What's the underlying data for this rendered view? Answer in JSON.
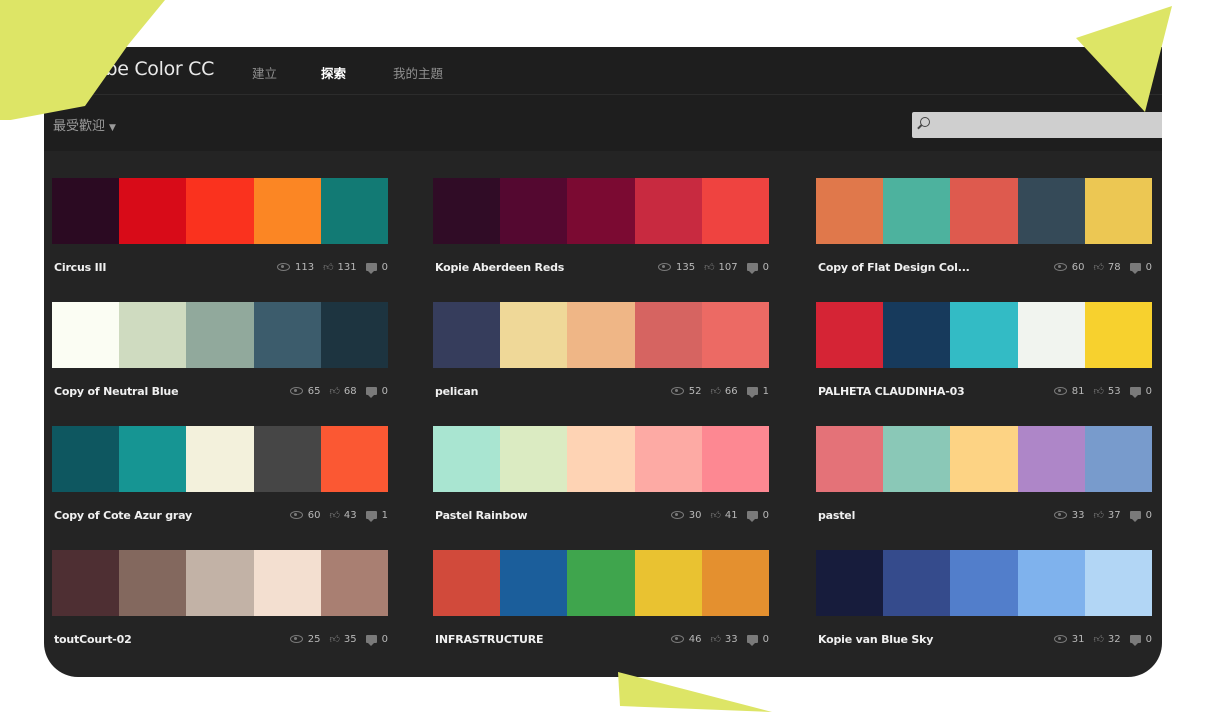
{
  "app": {
    "brand": "Adobe Color CC",
    "nav": [
      "建立",
      "探索",
      "我的主題"
    ],
    "active_nav": 1
  },
  "toolbar": {
    "sort_label": "最受歡迎",
    "search_placeholder": ""
  },
  "themes": [
    {
      "name": "Circus III",
      "colors": [
        "#2b0a22",
        "#d80b18",
        "#fa321e",
        "#fb8624",
        "#127a74"
      ],
      "views": "113",
      "likes": "131",
      "comments": "0"
    },
    {
      "name": "Kopie Aberdeen Reds",
      "colors": [
        "#300c26",
        "#540830",
        "#7b0a32",
        "#c82a40",
        "#ef4340"
      ],
      "views": "135",
      "likes": "107",
      "comments": "0"
    },
    {
      "name": "Copy of Flat Design Col...",
      "colors": [
        "#e0784b",
        "#4db29e",
        "#de5a4e",
        "#354a58",
        "#ecc753"
      ],
      "views": "60",
      "likes": "78",
      "comments": "0"
    },
    {
      "name": "Copy of Neutral Blue",
      "colors": [
        "#fbfdf3",
        "#cfdbc0",
        "#91a99c",
        "#3c5c6c",
        "#1d3440"
      ],
      "views": "65",
      "likes": "68",
      "comments": "0"
    },
    {
      "name": "pelican",
      "colors": [
        "#363d5c",
        "#efd898",
        "#efb686",
        "#d66461",
        "#ec6a64"
      ],
      "views": "52",
      "likes": "66",
      "comments": "1"
    },
    {
      "name": "PALHETA CLAUDINHA-03",
      "colors": [
        "#d52435",
        "#173a5c",
        "#33bbc5",
        "#f1f4ef",
        "#f7d12e"
      ],
      "views": "81",
      "likes": "53",
      "comments": "0"
    },
    {
      "name": "Copy of Cote Azur gray",
      "colors": [
        "#0e5760",
        "#169593",
        "#f3f1dc",
        "#464646",
        "#fb5833"
      ],
      "views": "60",
      "likes": "43",
      "comments": "1"
    },
    {
      "name": "Pastel Rainbow",
      "colors": [
        "#a9e5d1",
        "#dbebc2",
        "#fed3b4",
        "#fdaaa4",
        "#fd8892"
      ],
      "views": "30",
      "likes": "41",
      "comments": "0"
    },
    {
      "name": "pastel",
      "colors": [
        "#e47278",
        "#8ac8b7",
        "#fdd384",
        "#ae86c8",
        "#789bcc"
      ],
      "views": "33",
      "likes": "37",
      "comments": "0"
    },
    {
      "name": "toutCourt-02",
      "colors": [
        "#4e2f33",
        "#83685e",
        "#c2b2a6",
        "#f3dfd0",
        "#a97f72"
      ],
      "views": "25",
      "likes": "35",
      "comments": "0"
    },
    {
      "name": "INFRASTRUCTURE",
      "colors": [
        "#d14a3b",
        "#1b5e9b",
        "#3fa54d",
        "#e9c231",
        "#e4902f"
      ],
      "views": "46",
      "likes": "33",
      "comments": "0"
    },
    {
      "name": "Kopie van Blue Sky",
      "colors": [
        "#171c3c",
        "#354b8c",
        "#527ecb",
        "#7fb2ed",
        "#b2d6f5"
      ],
      "views": "31",
      "likes": "32",
      "comments": "0"
    }
  ],
  "decor": {
    "shape_color": "#dde566"
  }
}
